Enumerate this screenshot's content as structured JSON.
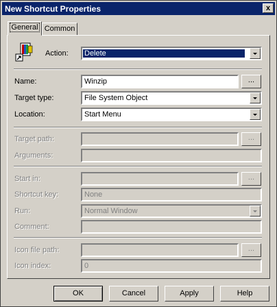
{
  "window": {
    "title": "New Shortcut Properties",
    "close_glyph": "x"
  },
  "tabs": [
    {
      "label": "General"
    },
    {
      "label": "Common"
    }
  ],
  "action": {
    "label": "Action:",
    "value": "Delete"
  },
  "name": {
    "label": "Name:",
    "value": "Winzip",
    "browse": "..."
  },
  "target_type": {
    "label": "Target type:",
    "value": "File System Object"
  },
  "location": {
    "label": "Location:",
    "value": "Start Menu"
  },
  "target_path": {
    "label": "Target path:",
    "value": "",
    "browse": "..."
  },
  "arguments": {
    "label": "Arguments:",
    "value": ""
  },
  "start_in": {
    "label": "Start in:",
    "value": "",
    "browse": "..."
  },
  "shortcut_key": {
    "label": "Shortcut key:",
    "value": "None"
  },
  "run": {
    "label": "Run:",
    "value": "Normal Window"
  },
  "comment": {
    "label": "Comment:",
    "value": ""
  },
  "icon_file_path": {
    "label": "Icon file path:",
    "value": "",
    "browse": "..."
  },
  "icon_index": {
    "label": "Icon index:",
    "value": "0"
  },
  "buttons": {
    "ok": "OK",
    "cancel": "Cancel",
    "apply": "Apply",
    "help": "Help"
  },
  "icons": {
    "shortcut": "shortcut-app-icon",
    "close": "close-icon",
    "dropdown": "chevron-down-icon"
  }
}
